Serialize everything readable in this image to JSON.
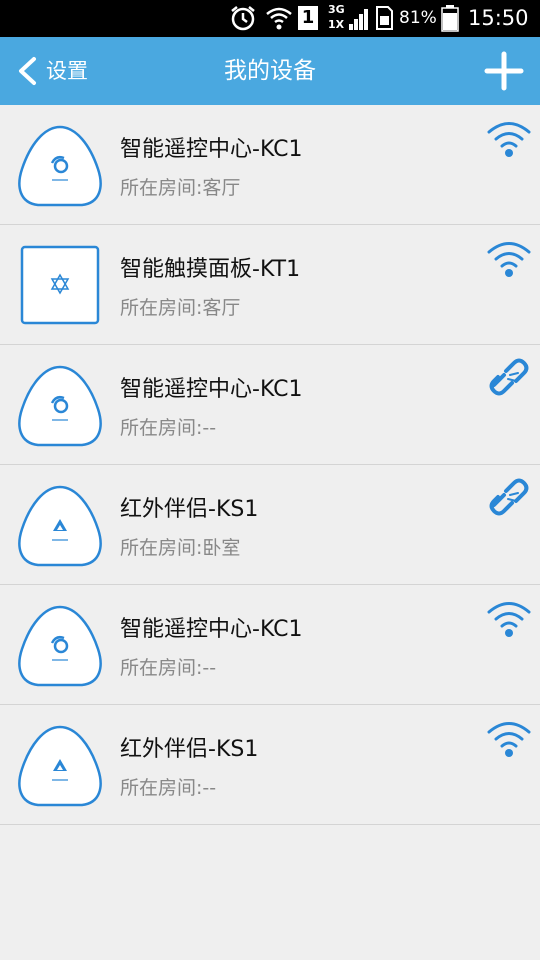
{
  "status_bar": {
    "network_type_top": "3G",
    "network_type_bottom": "1X",
    "sim_slot": "1",
    "battery": "81%",
    "time": "15:50"
  },
  "header": {
    "back_label": "设置",
    "title": "我的设备",
    "add_icon": "plus-icon"
  },
  "colors": {
    "accent": "#4aa8e0",
    "icon_blue": "#2a87d6",
    "background": "#efefef"
  },
  "devices": [
    {
      "name": "智能遥控中心-KC1",
      "room": "所在房间:客厅",
      "type": "kc1",
      "status": "wifi"
    },
    {
      "name": "智能触摸面板-KT1",
      "room": "所在房间:客厅",
      "type": "kt1",
      "status": "wifi"
    },
    {
      "name": "智能遥控中心-KC1",
      "room": "所在房间:--",
      "type": "kc1",
      "status": "link-broken"
    },
    {
      "name": "红外伴侣-KS1",
      "room": "所在房间:卧室",
      "type": "ks1",
      "status": "link-broken"
    },
    {
      "name": "智能遥控中心-KC1",
      "room": "所在房间:--",
      "type": "kc1",
      "status": "wifi"
    },
    {
      "name": "红外伴侣-KS1",
      "room": "所在房间:--",
      "type": "ks1",
      "status": "wifi"
    }
  ]
}
